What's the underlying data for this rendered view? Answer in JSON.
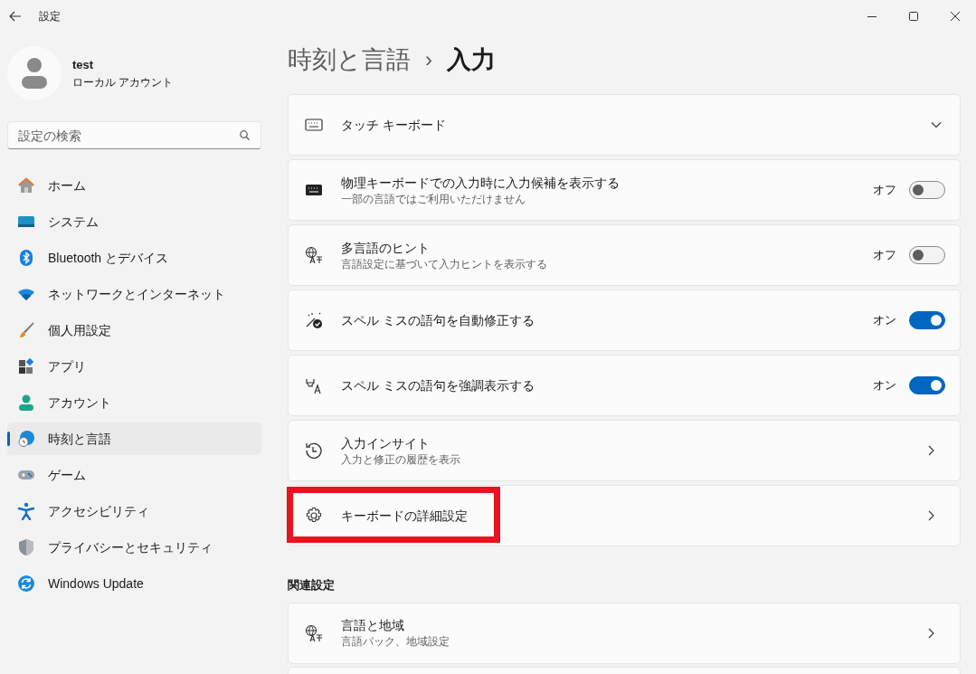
{
  "window": {
    "title": "設定"
  },
  "account": {
    "name": "test",
    "type": "ローカル アカウント"
  },
  "search": {
    "placeholder": "設定の検索"
  },
  "sidebar": {
    "items": [
      {
        "label": "ホーム",
        "selected": false
      },
      {
        "label": "システム",
        "selected": false
      },
      {
        "label": "Bluetooth とデバイス",
        "selected": false
      },
      {
        "label": "ネットワークとインターネット",
        "selected": false
      },
      {
        "label": "個人用設定",
        "selected": false
      },
      {
        "label": "アプリ",
        "selected": false
      },
      {
        "label": "アカウント",
        "selected": false
      },
      {
        "label": "時刻と言語",
        "selected": true
      },
      {
        "label": "ゲーム",
        "selected": false
      },
      {
        "label": "アクセシビリティ",
        "selected": false
      },
      {
        "label": "プライバシーとセキュリティ",
        "selected": false
      },
      {
        "label": "Windows Update",
        "selected": false
      }
    ]
  },
  "breadcrumb": {
    "parent": "時刻と言語",
    "separator": "›",
    "current": "入力"
  },
  "settings": [
    {
      "kind": "expand",
      "title": "タッチ キーボード",
      "expanded": false
    },
    {
      "kind": "toggle",
      "title": "物理キーボードでの入力時に入力候補を表示する",
      "description": "一部の言語ではご利用いただけません",
      "on": false,
      "state_label": "オフ"
    },
    {
      "kind": "toggle",
      "title": "多言語のヒント",
      "description": "言語設定に基づいて入力ヒントを表示する",
      "on": false,
      "state_label": "オフ"
    },
    {
      "kind": "toggle",
      "title": "スペル ミスの語句を自動修正する",
      "on": true,
      "state_label": "オン"
    },
    {
      "kind": "toggle",
      "title": "スペル ミスの語句を強調表示する",
      "on": true,
      "state_label": "オン"
    },
    {
      "kind": "link",
      "title": "入力インサイト",
      "description": "入力と修正の履歴を表示"
    },
    {
      "kind": "link",
      "title": "キーボードの詳細設定",
      "highlighted": true
    }
  ],
  "related": {
    "heading": "関連設定",
    "items": [
      {
        "kind": "link",
        "title": "言語と地域",
        "description": "言語パック、地域設定"
      }
    ]
  }
}
